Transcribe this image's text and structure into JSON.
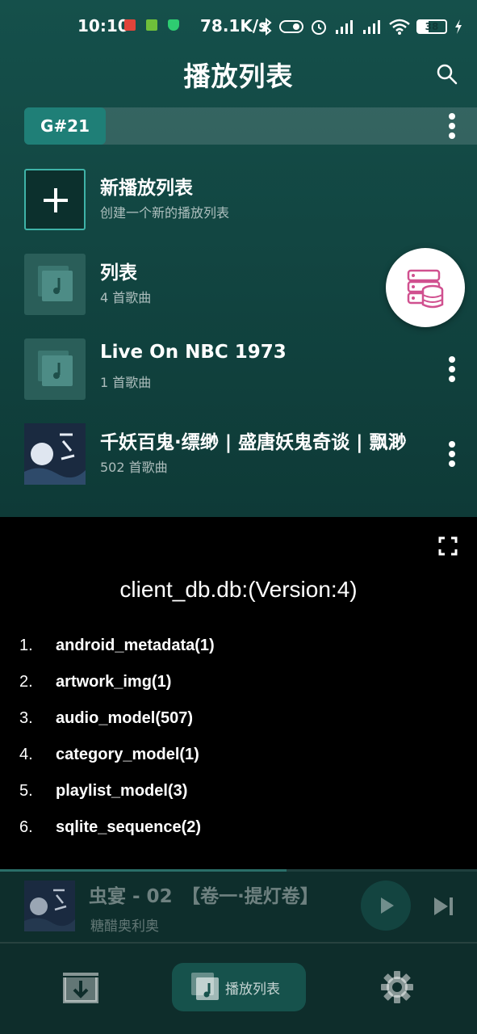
{
  "status_bar": {
    "time": "10:10",
    "network_speed": "78.1K/s",
    "battery_level": "38"
  },
  "header": {
    "title": "播放列表"
  },
  "tabs": [
    {
      "label": "G#21",
      "active": true
    }
  ],
  "playlists": [
    {
      "title": "新播放列表",
      "subtitle": "创建一个新的播放列表",
      "kind": "new"
    },
    {
      "title": "列表",
      "subtitle": "4 首歌曲",
      "kind": "list"
    },
    {
      "title": "Live On NBC 1973",
      "subtitle": "1 首歌曲",
      "kind": "list"
    },
    {
      "title": "千妖百鬼·缥缈 | 盛唐妖鬼奇谈 | 飘渺",
      "subtitle": "502 首歌曲",
      "kind": "album"
    }
  ],
  "db_panel": {
    "title": "client_db.db:(Version:4)",
    "tables": [
      {
        "num": "1.",
        "name": "android_metadata(1)"
      },
      {
        "num": "2.",
        "name": "artwork_img(1)"
      },
      {
        "num": "3.",
        "name": "audio_model(507)"
      },
      {
        "num": "4.",
        "name": "category_model(1)"
      },
      {
        "num": "5.",
        "name": "playlist_model(3)"
      },
      {
        "num": "6.",
        "name": "sqlite_sequence(2)"
      }
    ]
  },
  "now_playing": {
    "title": "虫宴 - 02　【卷一·提灯卷】",
    "artist": "糖醋奥利奥",
    "progress": 0.6
  },
  "bottom_nav": {
    "playlists_label": "播放列表"
  },
  "colors": {
    "accent": "#1f7f77",
    "background": "#124642",
    "db_icon": "#d0508f"
  }
}
